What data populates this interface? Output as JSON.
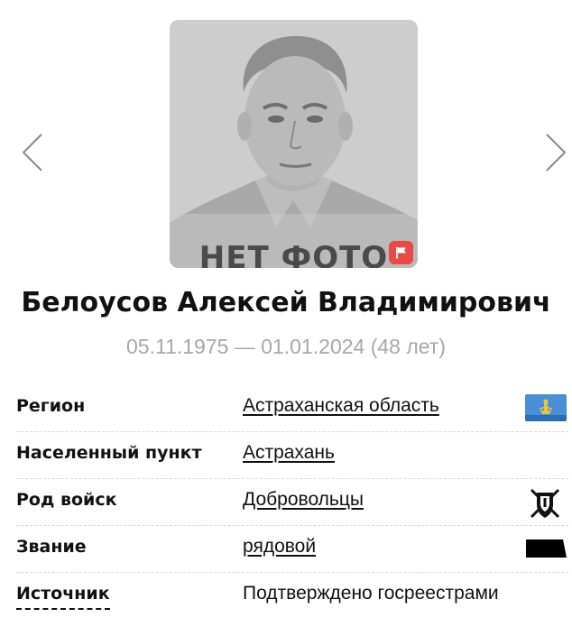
{
  "photo": {
    "placeholder_text": "НЕТ ФОТО",
    "report_icon": "flag-icon",
    "report_color": "#e84a4a"
  },
  "navigation": {
    "prev_icon": "chevron-left-icon",
    "next_icon": "chevron-right-icon"
  },
  "person": {
    "name": "Белоусов Алексей Владимирович",
    "dates": "05.11.1975 — 01.01.2024 (48 лет)"
  },
  "details": [
    {
      "label": "Регион",
      "value": "Астраханская область",
      "is_link": true,
      "icon": "region-flag-icon"
    },
    {
      "label": "Населенный пункт",
      "value": "Астрахань",
      "is_link": true
    },
    {
      "label": "Род войск",
      "value": "Добровольцы",
      "is_link": true,
      "icon": "volunteer-emblem-icon"
    },
    {
      "label": "Звание",
      "value": "рядовой",
      "is_link": true,
      "icon": "rank-insignia-icon"
    },
    {
      "label": "Источник",
      "value": "Подтверждено госреестрами",
      "is_link": false
    }
  ]
}
